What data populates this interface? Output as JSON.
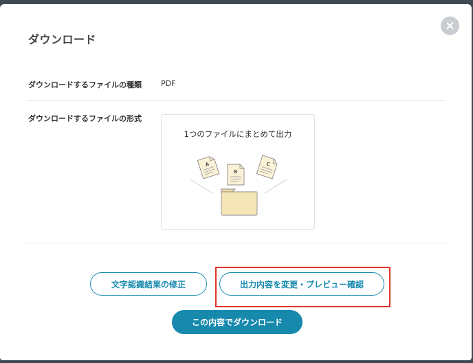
{
  "dialog": {
    "title": "ダウンロード",
    "close_icon": "close-icon"
  },
  "file_type": {
    "label": "ダウンロードするファイルの種類",
    "value": "PDF"
  },
  "file_format": {
    "label": "ダウンロードするファイルの形式",
    "option_label": "1つのファイルにまとめて出力",
    "documents": [
      "A",
      "B",
      "C"
    ],
    "illustration_icon": "merge-into-folder-icon"
  },
  "actions": {
    "fix_ocr_label": "文字認識結果の修正",
    "change_preview_label": "出力内容を変更・プレビュー確認",
    "download_label": "この内容でダウンロード"
  },
  "colors": {
    "accent": "#1689ad",
    "highlight": "#e2332b",
    "folder": "#f5e6b8",
    "paper": "#fbf1d6"
  }
}
